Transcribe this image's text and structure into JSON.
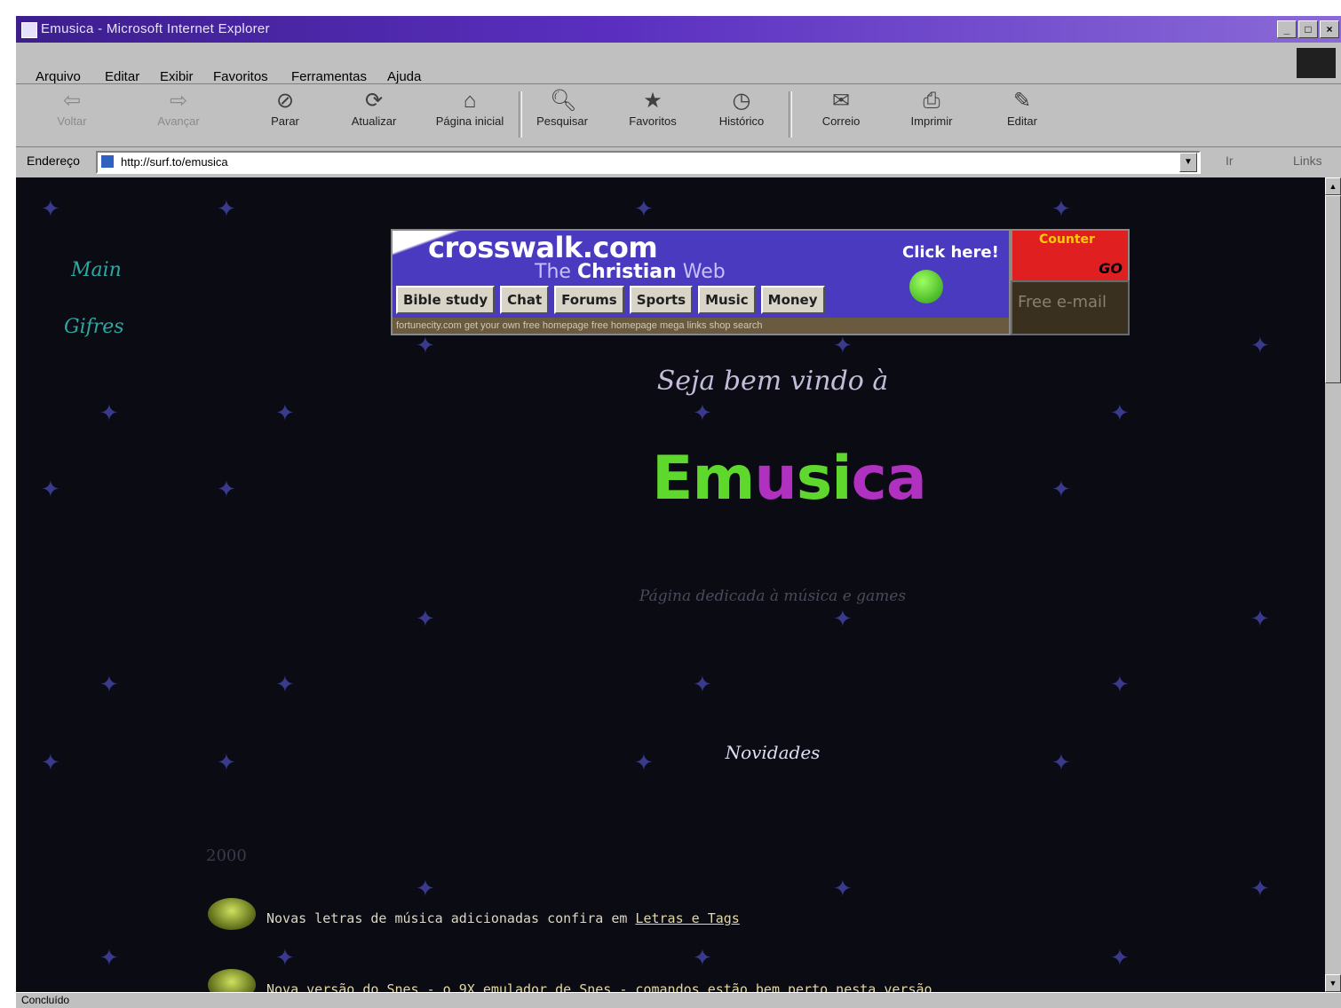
{
  "window": {
    "title": "Emusica - Microsoft Internet Explorer",
    "buttons": [
      "_",
      "□",
      "×"
    ]
  },
  "menu": [
    {
      "label": "Arquivo"
    },
    {
      "label": "Editar"
    },
    {
      "label": "Exibir"
    },
    {
      "label": "Favoritos"
    },
    {
      "label": "Ferramentas"
    },
    {
      "label": "Ajuda"
    }
  ],
  "toolbar": [
    {
      "label": "Voltar",
      "icon": "back-arrow-icon"
    },
    {
      "label": "Avançar",
      "icon": "forward-arrow-icon"
    },
    {
      "label": "Parar",
      "icon": "stop-icon"
    },
    {
      "label": "Atualizar",
      "icon": "refresh-icon"
    },
    {
      "label": "Página inicial",
      "icon": "home-icon"
    },
    {
      "label": "Pesquisar",
      "icon": "search-icon"
    },
    {
      "label": "Favoritos",
      "icon": "favorites-icon"
    },
    {
      "label": "Histórico",
      "icon": "history-icon"
    },
    {
      "label": "Correio",
      "icon": "mail-icon"
    },
    {
      "label": "Imprimir",
      "icon": "print-icon"
    },
    {
      "label": "Editar",
      "icon": "edit-icon"
    }
  ],
  "address": {
    "label": "Endereço",
    "url": "http://surf.to/emusica",
    "go": "Ir",
    "links": "Links"
  },
  "page": {
    "nav": [
      "Main",
      "Gifres"
    ],
    "banner": {
      "logo": "crosswalk.com",
      "tagline_pre": "The",
      "tagline_bold": "Christian",
      "tagline_post": "Web",
      "click": "Click here!",
      "buttons": [
        "Bible study",
        "Chat",
        "Forums",
        "Sports",
        "Music",
        "Money"
      ],
      "footer": "fortunecity.com  get your own free homepage  free homepage  mega links  shop  search"
    },
    "counter": {
      "title": "Counter",
      "go": "GO"
    },
    "email": "Free e-mail",
    "welcome": "Seja bem vindo à",
    "brand_green": "Em",
    "brand_purple": "u",
    "brand_green2": "si",
    "brand_purple2": "ca",
    "subtitle": "Página dedicada à música e games",
    "news_title": "Novidades",
    "year": "2000",
    "items": [
      {
        "text": "Novas letras de música adicionadas confira em",
        "link": "Letras e Tags"
      },
      {
        "text": "Nova versão do Snes - o 9X emulador de Snes - comandos estão bem perto nesta versão",
        "link": ""
      }
    ]
  },
  "status": {
    "text": "Concluído"
  },
  "colors": {
    "title_bar": "#3c1e8c",
    "page_bg": "#0b0b14",
    "brand_green": "#5ed82c",
    "brand_purple": "#b030c0",
    "nav_text": "#2ea8a0"
  }
}
